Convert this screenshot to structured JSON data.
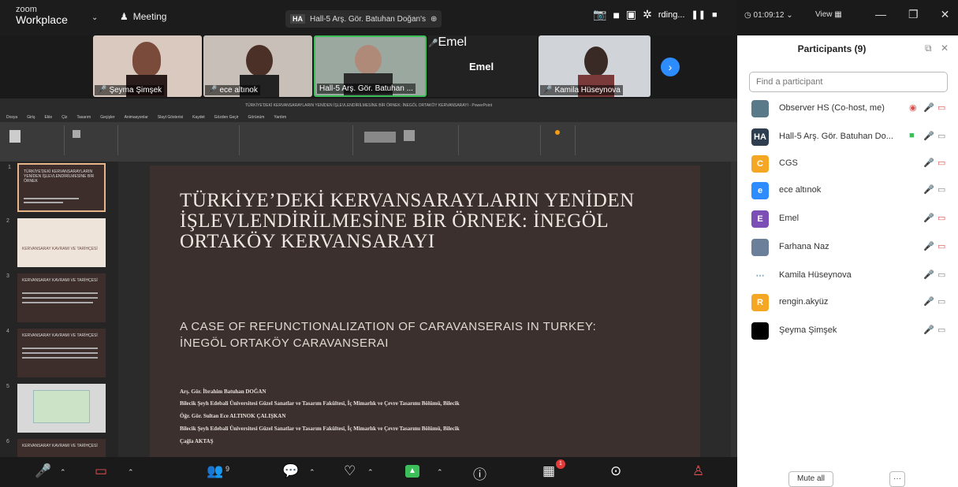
{
  "app": {
    "brand_top": "zoom",
    "brand_bottom": "Workplace",
    "meeting_label": "Meeting",
    "share_badge": "HA",
    "share_title": "Hall-5 Arş. Gör. Batuhan Doğan's",
    "recording_text": "rding...",
    "timer": "◷ 01:09:12 ⌄",
    "view_label": "View"
  },
  "videos": {
    "tiles": [
      {
        "label": "Şeyma Şimşek"
      },
      {
        "label": "ece altınok"
      },
      {
        "label": "Hall-5 Arş. Gör. Batuhan ..."
      },
      {
        "label": "Emel"
      },
      {
        "label": "Kamila Hüseynova"
      }
    ],
    "emel_name": "Emel"
  },
  "ppt": {
    "title_bar": "TÜRKİYE'DEKİ KERVANSARAYLARIN YENİDEN İŞLEVLENDİRİLMESİNE BİR ÖRNEK: İNEGÖL ORTAKÖY KERVANSARAYI - PowerPoint",
    "tabs": [
      "Dosya",
      "Giriş",
      "Ekle",
      "Çiz",
      "Tasarım",
      "Geçişler",
      "Animasyonlar",
      "Slayt Gösterisi",
      "Kaydet",
      "Gözden Geçir",
      "Görünüm",
      "Yardım"
    ],
    "thumbs": [
      {
        "num": "1",
        "text": "TÜRKİYE'DEKİ KERVANSARAYLARIN YENİDEN İŞLEVLENDİRİLMESİNE BİR ÖRNEK"
      },
      {
        "num": "2",
        "text": "KERVANSARAY KAVRAMI VE TARİHÇESİ"
      },
      {
        "num": "3",
        "text": "KERVANSARAY KAVRAMI VE TARİHÇESİ"
      },
      {
        "num": "4",
        "text": "KERVANSARAY KAVRAMI VE TARİHÇESİ"
      },
      {
        "num": "5",
        "text": ""
      },
      {
        "num": "6",
        "text": "KERVANSARAY KAVRAMI VE TARİHÇESİ"
      }
    ],
    "slide": {
      "title": "TÜRKİYE’DEKİ KERVANSARAYLARIN YENİDEN İŞLEVLENDİRİLMESİNE BİR ÖRNEK: İNEGÖL ORTAKÖY KERVANSARAYI",
      "subtitle": "A CASE OF REFUNCTIONALIZATION OF CARAVANSERAIS IN TURKEY: İNEGÖL ORTAKÖY CARAVANSERAI",
      "authors": [
        "Arş. Gör. İbrahim Batuhan DOĞAN",
        "Bilecik Şeyh Edebali Üniversitesi Güzel Sanatlar ve Tasarım Fakültesi, İç Mimarlık ve Çevre Tasarımı Bölümü, Bilecik",
        "Öğr. Gör. Sultan Ece ALTINOK ÇALIŞKAN",
        "Bilecik Şeyh Edebali Üniversitesi Güzel Sanatlar ve Tasarım Fakültesi, İç Mimarlık ve Çevre Tasarımı Bölümü, Bilecik",
        "Çağla AKTAŞ"
      ]
    }
  },
  "toolbar": {
    "participants_count": "9",
    "notif_count": "1"
  },
  "panel": {
    "title": "Participants (9)",
    "search_placeholder": "Find a participant",
    "mute_all": "Mute all",
    "more": "···",
    "participants": [
      {
        "initial": "",
        "name": "Observer HS (Co-host, me)",
        "color": "#5a7a8a"
      },
      {
        "initial": "HA",
        "name": "Hall-5 Arş. Gör. Batuhan Do...",
        "color": "#2e3d4f"
      },
      {
        "initial": "C",
        "name": "CGS",
        "color": "#f5a623"
      },
      {
        "initial": "e",
        "name": "ece altınok",
        "color": "#2d8cff"
      },
      {
        "initial": "E",
        "name": "Emel",
        "color": "#7b4fb5"
      },
      {
        "initial": "",
        "name": "Farhana Naz",
        "color": "#6b7f9a"
      },
      {
        "initial": "",
        "name": "Kamila Hüseynova",
        "color": "#ffffff"
      },
      {
        "initial": "R",
        "name": "rengin.akyüz",
        "color": "#f5a623"
      },
      {
        "initial": "",
        "name": "Şeyma Şimşek",
        "color": "#000000"
      }
    ]
  }
}
